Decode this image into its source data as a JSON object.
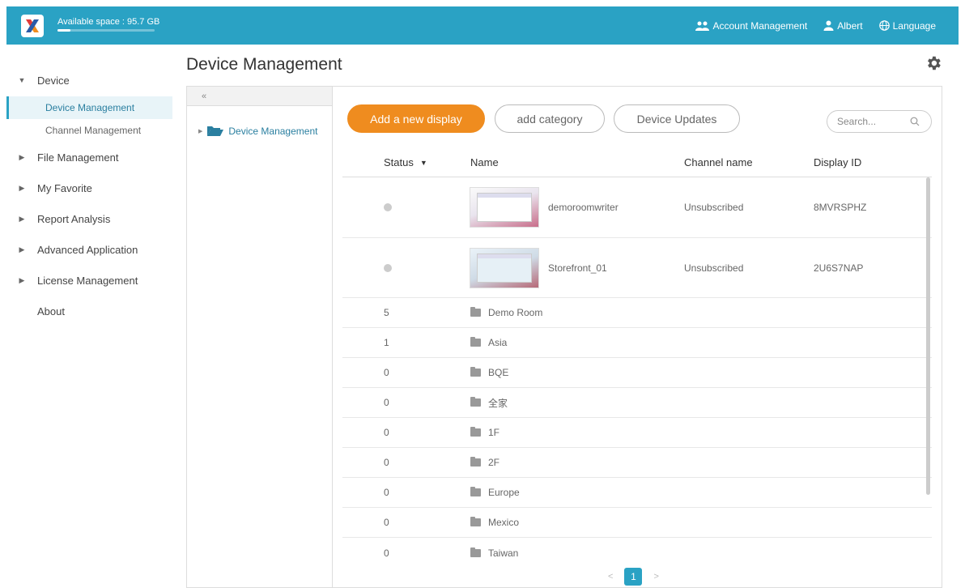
{
  "header": {
    "available_space": "Available space : 95.7 GB",
    "space_used_fraction": 0.13,
    "account_management": "Account Management",
    "user": "Albert",
    "language": "Language"
  },
  "sidebar": {
    "device": "Device",
    "device_management": "Device Management",
    "channel_management": "Channel Management",
    "file_management": "File Management",
    "my_favorite": "My Favorite",
    "report_analysis": "Report Analysis",
    "advanced_application": "Advanced Application",
    "license_management": "License Management",
    "about": "About"
  },
  "page": {
    "title": "Device Management"
  },
  "tree": {
    "collapse": "«",
    "root": "Device Management"
  },
  "toolbar": {
    "add_display": "Add a new display",
    "add_category": "add category",
    "device_updates": "Device Updates",
    "search_placeholder": "Search..."
  },
  "table": {
    "headers": {
      "status": "Status",
      "name": "Name",
      "channel": "Channel name",
      "display_id": "Display ID"
    },
    "devices": [
      {
        "name": "demoroomwriter",
        "channel": "Unsubscribed",
        "display_id": "8MVRSPHZ"
      },
      {
        "name": "Storefront_01",
        "channel": "Unsubscribed",
        "display_id": "2U6S7NAP"
      }
    ],
    "folders": [
      {
        "count": "5",
        "name": "Demo Room"
      },
      {
        "count": "1",
        "name": "Asia"
      },
      {
        "count": "0",
        "name": "BQE"
      },
      {
        "count": "0",
        "name": "全家"
      },
      {
        "count": "0",
        "name": "1F"
      },
      {
        "count": "0",
        "name": "2F"
      },
      {
        "count": "0",
        "name": "Europe"
      },
      {
        "count": "0",
        "name": "Mexico"
      },
      {
        "count": "0",
        "name": "Taiwan"
      }
    ]
  },
  "pager": {
    "prev": "<",
    "current": "1",
    "next": ">"
  },
  "colors": {
    "accent": "#2aa2c4",
    "primary_button": "#ef8c1f"
  }
}
